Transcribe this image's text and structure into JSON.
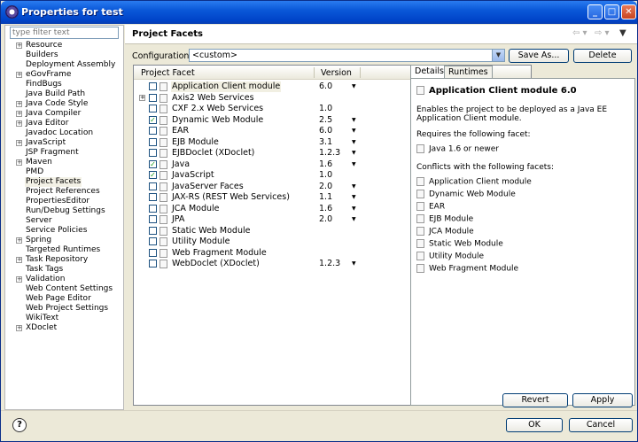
{
  "window": {
    "title": "Properties for test"
  },
  "filter": {
    "placeholder": "type filter text"
  },
  "tree": [
    {
      "label": "Resource",
      "expandable": true
    },
    {
      "label": "Builders",
      "expandable": false
    },
    {
      "label": "Deployment Assembly",
      "expandable": false
    },
    {
      "label": "eGovFrame",
      "expandable": true
    },
    {
      "label": "FindBugs",
      "expandable": false
    },
    {
      "label": "Java Build Path",
      "expandable": false
    },
    {
      "label": "Java Code Style",
      "expandable": true
    },
    {
      "label": "Java Compiler",
      "expandable": true
    },
    {
      "label": "Java Editor",
      "expandable": true
    },
    {
      "label": "Javadoc Location",
      "expandable": false
    },
    {
      "label": "JavaScript",
      "expandable": true
    },
    {
      "label": "JSP Fragment",
      "expandable": false
    },
    {
      "label": "Maven",
      "expandable": true
    },
    {
      "label": "PMD",
      "expandable": false
    },
    {
      "label": "Project Facets",
      "expandable": false,
      "selected": true
    },
    {
      "label": "Project References",
      "expandable": false
    },
    {
      "label": "PropertiesEditor",
      "expandable": false
    },
    {
      "label": "Run/Debug Settings",
      "expandable": false
    },
    {
      "label": "Server",
      "expandable": false
    },
    {
      "label": "Service Policies",
      "expandable": false
    },
    {
      "label": "Spring",
      "expandable": true
    },
    {
      "label": "Targeted Runtimes",
      "expandable": false
    },
    {
      "label": "Task Repository",
      "expandable": true
    },
    {
      "label": "Task Tags",
      "expandable": false
    },
    {
      "label": "Validation",
      "expandable": true
    },
    {
      "label": "Web Content Settings",
      "expandable": false
    },
    {
      "label": "Web Page Editor",
      "expandable": false
    },
    {
      "label": "Web Project Settings",
      "expandable": false
    },
    {
      "label": "WikiText",
      "expandable": false
    },
    {
      "label": "XDoclet",
      "expandable": true
    }
  ],
  "page": {
    "title": "Project Facets"
  },
  "configuration": {
    "label": "Configuration:",
    "value": "<custom>",
    "save_as": "Save As...",
    "delete": "Delete"
  },
  "facets_table": {
    "col_facet": "Project Facet",
    "col_version": "Version",
    "rows": [
      {
        "name": "Application Client module",
        "version": "6.0",
        "checked": false,
        "dropdown": true,
        "expandable": false,
        "selected": true
      },
      {
        "name": "Axis2 Web Services",
        "version": "",
        "checked": false,
        "dropdown": false,
        "expandable": true
      },
      {
        "name": "CXF 2.x Web Services",
        "version": "1.0",
        "checked": false,
        "dropdown": false,
        "expandable": false
      },
      {
        "name": "Dynamic Web Module",
        "version": "2.5",
        "checked": true,
        "dropdown": true,
        "expandable": false
      },
      {
        "name": "EAR",
        "version": "6.0",
        "checked": false,
        "dropdown": true,
        "expandable": false
      },
      {
        "name": "EJB Module",
        "version": "3.1",
        "checked": false,
        "dropdown": true,
        "expandable": false
      },
      {
        "name": "EJBDoclet (XDoclet)",
        "version": "1.2.3",
        "checked": false,
        "dropdown": true,
        "expandable": false
      },
      {
        "name": "Java",
        "version": "1.6",
        "checked": true,
        "dropdown": true,
        "expandable": false
      },
      {
        "name": "JavaScript",
        "version": "1.0",
        "checked": true,
        "dropdown": false,
        "expandable": false
      },
      {
        "name": "JavaServer Faces",
        "version": "2.0",
        "checked": false,
        "dropdown": true,
        "expandable": false
      },
      {
        "name": "JAX-RS (REST Web Services)",
        "version": "1.1",
        "checked": false,
        "dropdown": true,
        "expandable": false
      },
      {
        "name": "JCA Module",
        "version": "1.6",
        "checked": false,
        "dropdown": true,
        "expandable": false
      },
      {
        "name": "JPA",
        "version": "2.0",
        "checked": false,
        "dropdown": true,
        "expandable": false
      },
      {
        "name": "Static Web Module",
        "version": "",
        "checked": false,
        "dropdown": false,
        "expandable": false
      },
      {
        "name": "Utility Module",
        "version": "",
        "checked": false,
        "dropdown": false,
        "expandable": false
      },
      {
        "name": "Web Fragment Module",
        "version": "",
        "checked": false,
        "dropdown": false,
        "expandable": false
      },
      {
        "name": "WebDoclet (XDoclet)",
        "version": "1.2.3",
        "checked": false,
        "dropdown": true,
        "expandable": false
      }
    ]
  },
  "details": {
    "tab_details": "Details",
    "tab_runtimes": "Runtimes",
    "heading": "Application Client module 6.0",
    "description": "Enables the project to be deployed as a Java EE Application Client module.",
    "requires_label": "Requires the following facet:",
    "requires": [
      "Java 1.6 or newer"
    ],
    "conflicts_label": "Conflicts with the following facets:",
    "conflicts": [
      "Application Client module",
      "Dynamic Web Module",
      "EAR",
      "EJB Module",
      "JCA Module",
      "Static Web Module",
      "Utility Module",
      "Web Fragment Module"
    ]
  },
  "buttons": {
    "revert": "Revert",
    "apply": "Apply",
    "ok": "OK",
    "cancel": "Cancel",
    "help": "?"
  }
}
